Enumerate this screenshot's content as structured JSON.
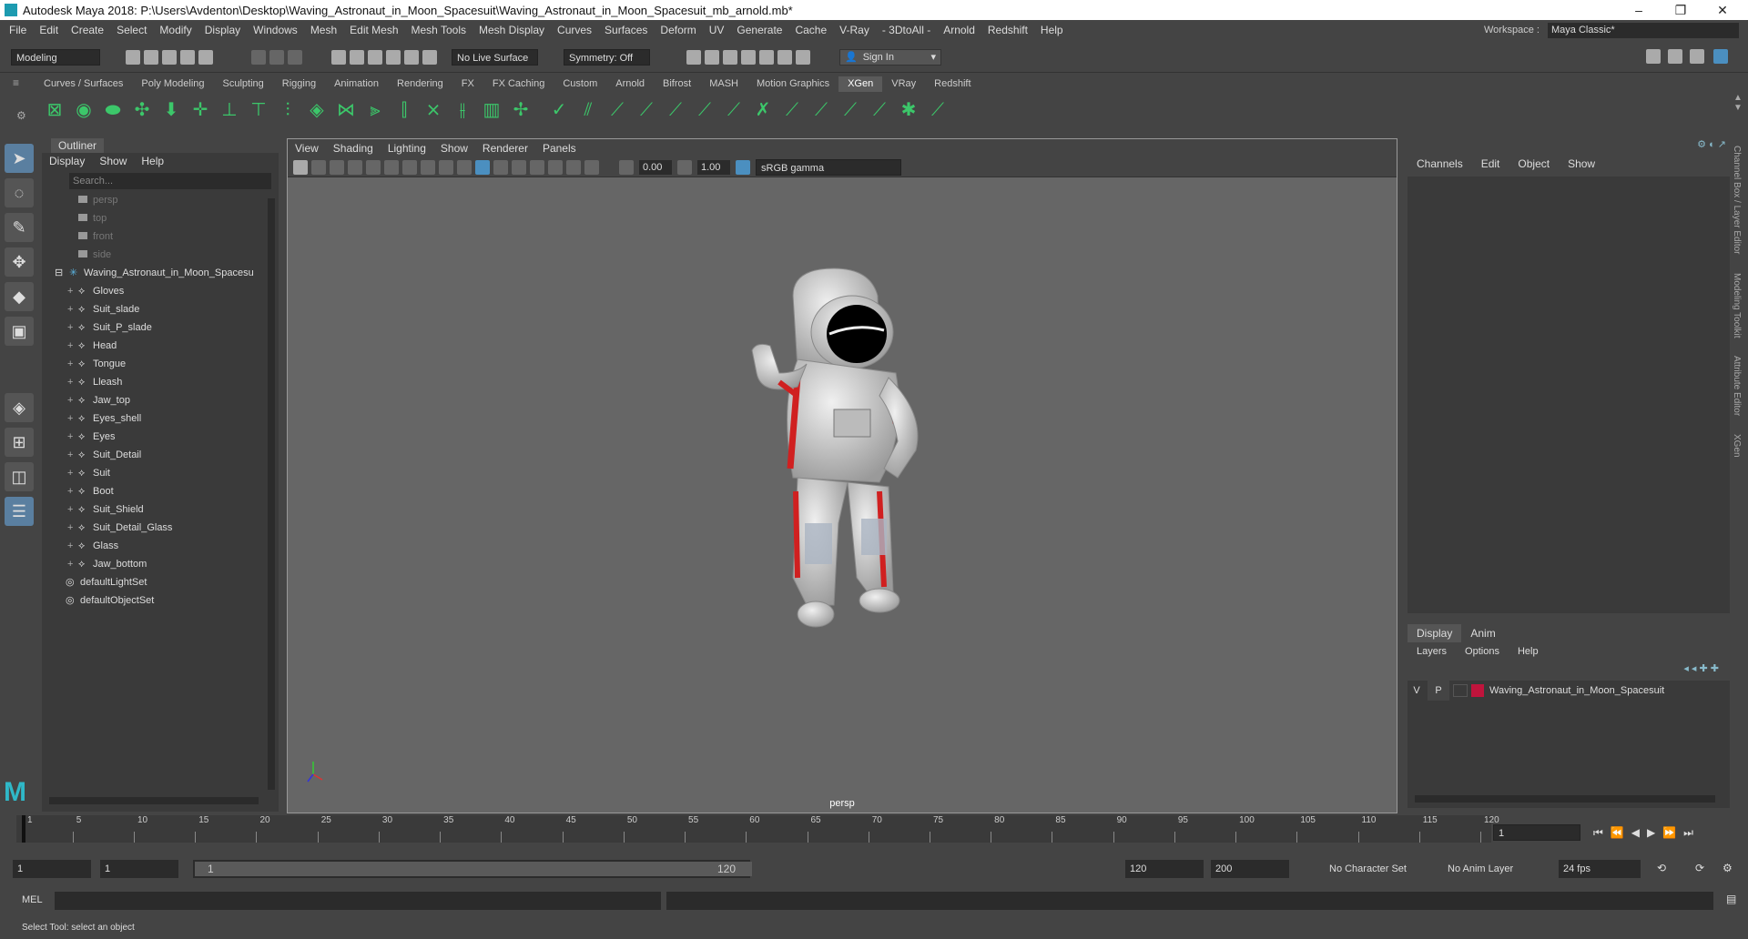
{
  "title": "Autodesk Maya 2018: P:\\Users\\Avdenton\\Desktop\\Waving_Astronaut_in_Moon_Spacesuit\\Waving_Astronaut_in_Moon_Spacesuit_mb_arnold.mb*",
  "menu": [
    "File",
    "Edit",
    "Create",
    "Select",
    "Modify",
    "Display",
    "Windows",
    "Mesh",
    "Edit Mesh",
    "Mesh Tools",
    "Mesh Display",
    "Curves",
    "Surfaces",
    "Deform",
    "UV",
    "Generate",
    "Cache",
    "V-Ray",
    "- 3DtoAll -",
    "Arnold",
    "Redshift",
    "Help"
  ],
  "workspace": {
    "label": "Workspace :",
    "value": "Maya Classic*"
  },
  "status": {
    "mode": "Modeling",
    "live_surface": "No Live Surface",
    "symmetry": "Symmetry: Off",
    "sign_in": "Sign In"
  },
  "shelf_tabs": [
    "Curves / Surfaces",
    "Poly Modeling",
    "Sculpting",
    "Rigging",
    "Animation",
    "Rendering",
    "FX",
    "FX Caching",
    "Custom",
    "Arnold",
    "Bifrost",
    "MASH",
    "Motion Graphics",
    "XGen",
    "VRay",
    "Redshift"
  ],
  "shelf_active": "XGen",
  "outliner": {
    "title": "Outliner",
    "menu": [
      "Display",
      "Show",
      "Help"
    ],
    "search_placeholder": "Search...",
    "cameras": [
      "persp",
      "top",
      "front",
      "side"
    ],
    "group": "Waving_Astronaut_in_Moon_Spacesu",
    "children": [
      "Gloves",
      "Suit_slade",
      "Suit_P_slade",
      "Head",
      "Tongue",
      "Lleash",
      "Jaw_top",
      "Eyes_shell",
      "Eyes",
      "Suit_Detail",
      "Suit",
      "Boot",
      "Suit_Shield",
      "Suit_Detail_Glass",
      "Glass",
      "Jaw_bottom"
    ],
    "sets": [
      "defaultLightSet",
      "defaultObjectSet"
    ]
  },
  "viewport": {
    "menu": [
      "View",
      "Shading",
      "Lighting",
      "Show",
      "Renderer",
      "Panels"
    ],
    "exposure": "0.00",
    "gamma": "1.00",
    "colorspace": "sRGB gamma",
    "camera": "persp"
  },
  "channelbox": {
    "menu": [
      "Channels",
      "Edit",
      "Object",
      "Show"
    ],
    "layer_tabs": [
      "Display",
      "Anim"
    ],
    "layer_menu": [
      "Layers",
      "Options",
      "Help"
    ],
    "layer": {
      "v": "V",
      "p": "P",
      "name": "Waving_Astronaut_in_Moon_Spacesuit",
      "color": "#c0143c"
    }
  },
  "side_tabs": [
    "Channel Box / Layer Editor",
    "Modeling Toolkit",
    "Attribute Editor",
    "XGen"
  ],
  "timeline": {
    "ticks": [
      "1",
      "5",
      "10",
      "15",
      "20",
      "25",
      "30",
      "35",
      "40",
      "45",
      "50",
      "55",
      "60",
      "65",
      "70",
      "75",
      "80",
      "85",
      "90",
      "95",
      "100",
      "105",
      "110",
      "115",
      "120"
    ],
    "current": "1"
  },
  "range": {
    "start": "1",
    "playback_start": "1",
    "slider_start": "1",
    "slider_end": "120",
    "playback_end": "120",
    "end": "200",
    "character_set": "No Character Set",
    "anim_layer": "No Anim Layer",
    "fps": "24 fps"
  },
  "cmd": {
    "label": "MEL"
  },
  "help": "Select Tool: select an object"
}
